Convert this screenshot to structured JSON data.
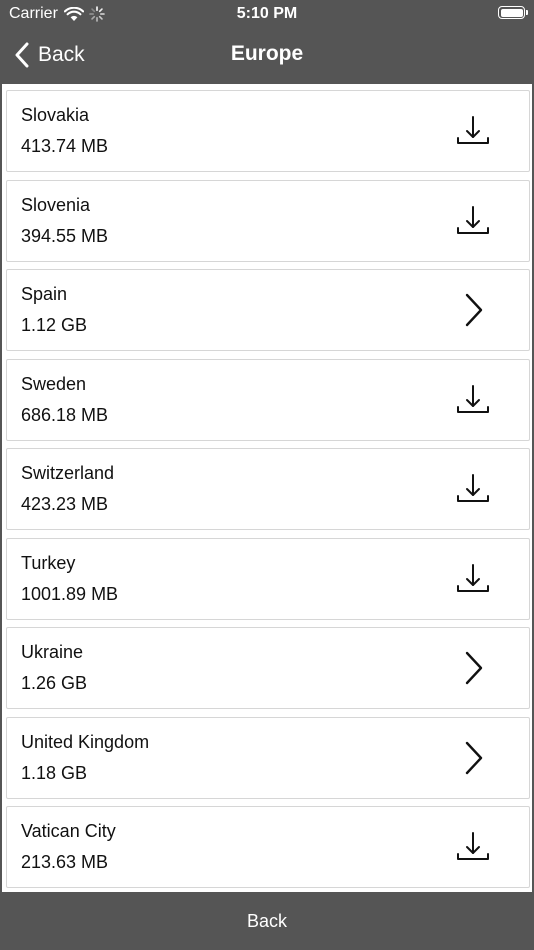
{
  "status_bar": {
    "carrier": "Carrier",
    "time": "5:10 PM",
    "icons": [
      "wifi-icon",
      "activity-spinner-icon",
      "battery-icon"
    ]
  },
  "nav_bar": {
    "back_label": "Back",
    "title": "Europe",
    "background_color": "#555555"
  },
  "items": [
    {
      "name": "Slovakia",
      "size": "413.74 MB",
      "action": "download"
    },
    {
      "name": "Slovenia",
      "size": "394.55 MB",
      "action": "download"
    },
    {
      "name": "Spain",
      "size": "1.12 GB",
      "action": "expand"
    },
    {
      "name": "Sweden",
      "size": "686.18 MB",
      "action": "download"
    },
    {
      "name": "Switzerland",
      "size": "423.23 MB",
      "action": "download"
    },
    {
      "name": "Turkey",
      "size": "1001.89 MB",
      "action": "download"
    },
    {
      "name": "Ukraine",
      "size": "1.26 GB",
      "action": "expand"
    },
    {
      "name": "United Kingdom",
      "size": "1.18 GB",
      "action": "expand"
    },
    {
      "name": "Vatican City",
      "size": "213.63 MB",
      "action": "download"
    }
  ],
  "bottom_bar": {
    "back_label": "Back"
  }
}
